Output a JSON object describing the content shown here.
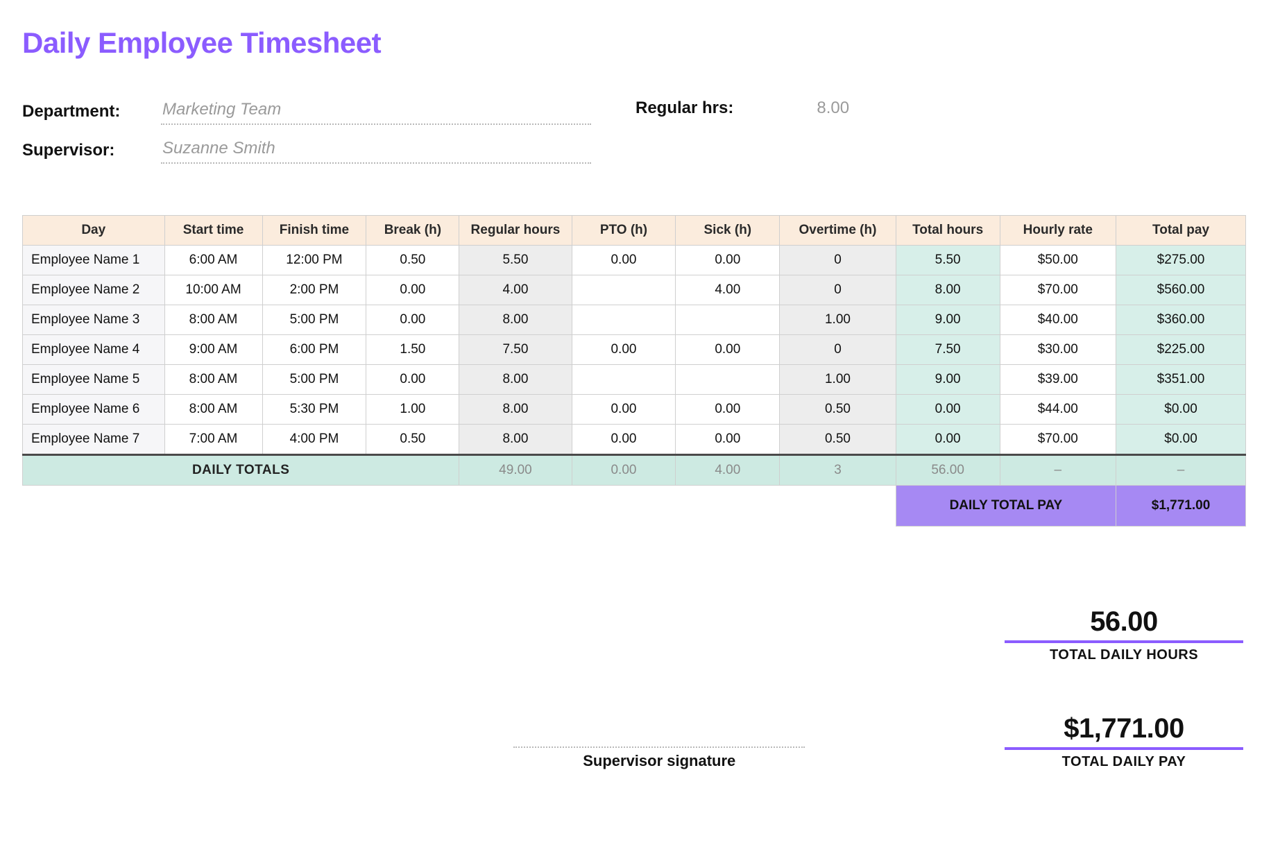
{
  "title": "Daily Employee Timesheet",
  "meta": {
    "department_label": "Department:",
    "department_value": "Marketing Team",
    "supervisor_label": "Supervisor:",
    "supervisor_value": "Suzanne Smith",
    "regular_hrs_label": "Regular hrs:",
    "regular_hrs_value": "8.00"
  },
  "columns": {
    "day": "Day",
    "start": "Start time",
    "finish": "Finish time",
    "break": "Break (h)",
    "regular": "Regular hours",
    "pto": "PTO (h)",
    "sick": "Sick (h)",
    "ot": "Overtime (h)",
    "total": "Total hours",
    "rate": "Hourly rate",
    "pay": "Total pay"
  },
  "rows": [
    {
      "name": "Employee Name 1",
      "start": "6:00 AM",
      "finish": "12:00 PM",
      "break": "0.50",
      "regular": "5.50",
      "pto": "0.00",
      "sick": "0.00",
      "ot": "0",
      "total": "5.50",
      "rate": "$50.00",
      "pay": "$275.00"
    },
    {
      "name": "Employee Name 2",
      "start": "10:00 AM",
      "finish": "2:00 PM",
      "break": "0.00",
      "regular": "4.00",
      "pto": "",
      "sick": "4.00",
      "ot": "0",
      "total": "8.00",
      "rate": "$70.00",
      "pay": "$560.00"
    },
    {
      "name": "Employee Name 3",
      "start": "8:00 AM",
      "finish": "5:00 PM",
      "break": "0.00",
      "regular": "8.00",
      "pto": "",
      "sick": "",
      "ot": "1.00",
      "total": "9.00",
      "rate": "$40.00",
      "pay": "$360.00"
    },
    {
      "name": "Employee Name 4",
      "start": "9:00 AM",
      "finish": "6:00 PM",
      "break": "1.50",
      "regular": "7.50",
      "pto": "0.00",
      "sick": "0.00",
      "ot": "0",
      "total": "7.50",
      "rate": "$30.00",
      "pay": "$225.00"
    },
    {
      "name": "Employee Name 5",
      "start": "8:00 AM",
      "finish": "5:00 PM",
      "break": "0.00",
      "regular": "8.00",
      "pto": "",
      "sick": "",
      "ot": "1.00",
      "total": "9.00",
      "rate": "$39.00",
      "pay": "$351.00"
    },
    {
      "name": "Employee Name 6",
      "start": "8:00 AM",
      "finish": "5:30 PM",
      "break": "1.00",
      "regular": "8.00",
      "pto": "0.00",
      "sick": "0.00",
      "ot": "0.50",
      "total": "0.00",
      "rate": "$44.00",
      "pay": "$0.00"
    },
    {
      "name": "Employee Name 7",
      "start": "7:00 AM",
      "finish": "4:00 PM",
      "break": "0.50",
      "regular": "8.00",
      "pto": "0.00",
      "sick": "0.00",
      "ot": "0.50",
      "total": "0.00",
      "rate": "$70.00",
      "pay": "$0.00"
    }
  ],
  "daily_totals": {
    "label": "DAILY TOTALS",
    "regular": "49.00",
    "pto": "0.00",
    "sick": "4.00",
    "ot": "3",
    "total": "56.00",
    "rate": "–",
    "pay": "–"
  },
  "pay_total": {
    "label": "DAILY TOTAL PAY",
    "value": "$1,771.00"
  },
  "summary": {
    "hours_value": "56.00",
    "hours_label": "TOTAL DAILY HOURS",
    "pay_value": "$1,771.00",
    "pay_label": "TOTAL DAILY PAY",
    "signature_label": "Supervisor signature"
  }
}
